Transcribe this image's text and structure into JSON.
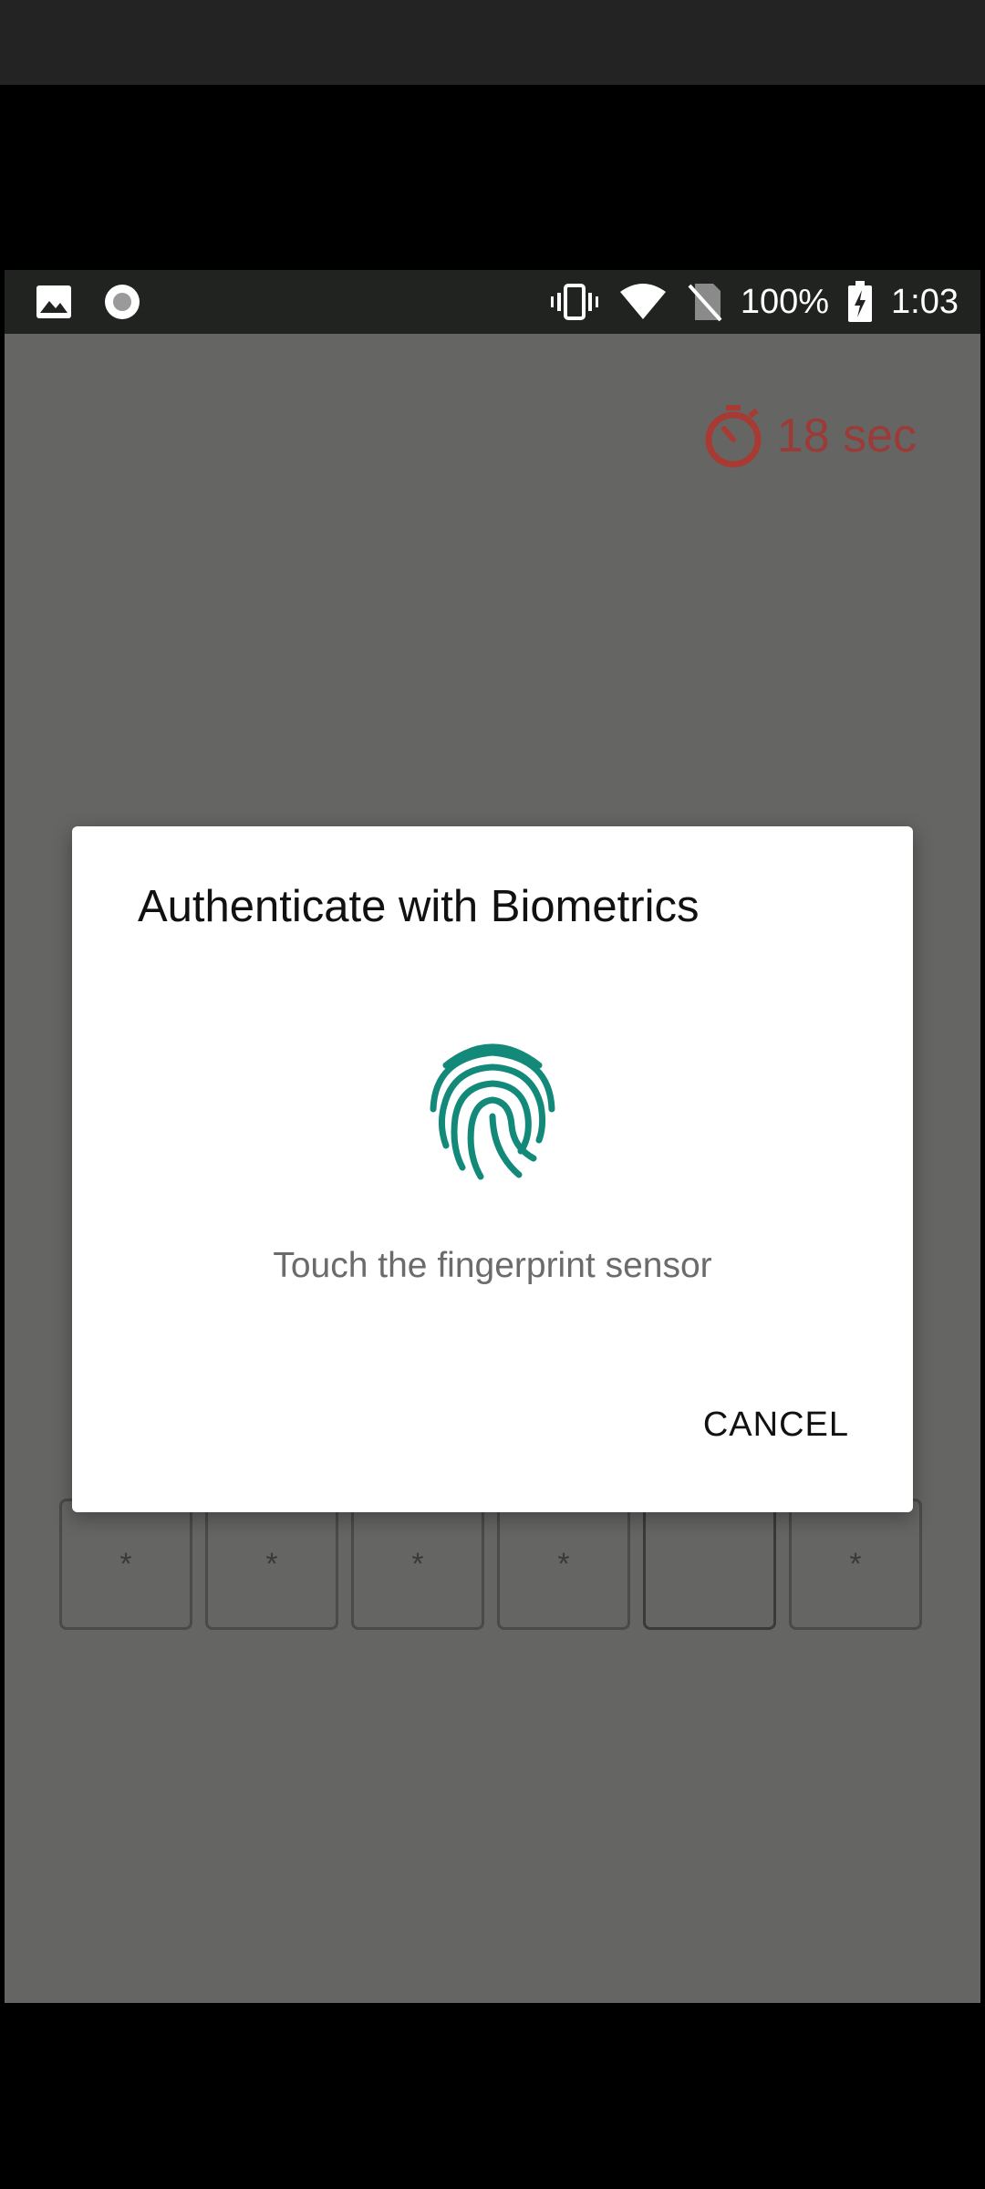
{
  "status_bar": {
    "icons_left": [
      "image-icon",
      "record-icon"
    ],
    "icons_right": [
      "vibrate-icon",
      "wifi-icon",
      "no-sim-icon",
      "battery-charging-icon"
    ],
    "battery": "100%",
    "time": "1:03"
  },
  "timer": {
    "icon": "stopwatch-icon",
    "text": "18 sec",
    "color": "#9b3b37"
  },
  "pin": {
    "boxes": [
      "*",
      "*",
      "*",
      "*",
      "",
      "*"
    ]
  },
  "dialog": {
    "title": "Authenticate with Biometrics",
    "icon": "fingerprint-icon",
    "icon_color": "#13897a",
    "description": "Touch the fingerprint sensor",
    "cancel_label": "CANCEL"
  }
}
